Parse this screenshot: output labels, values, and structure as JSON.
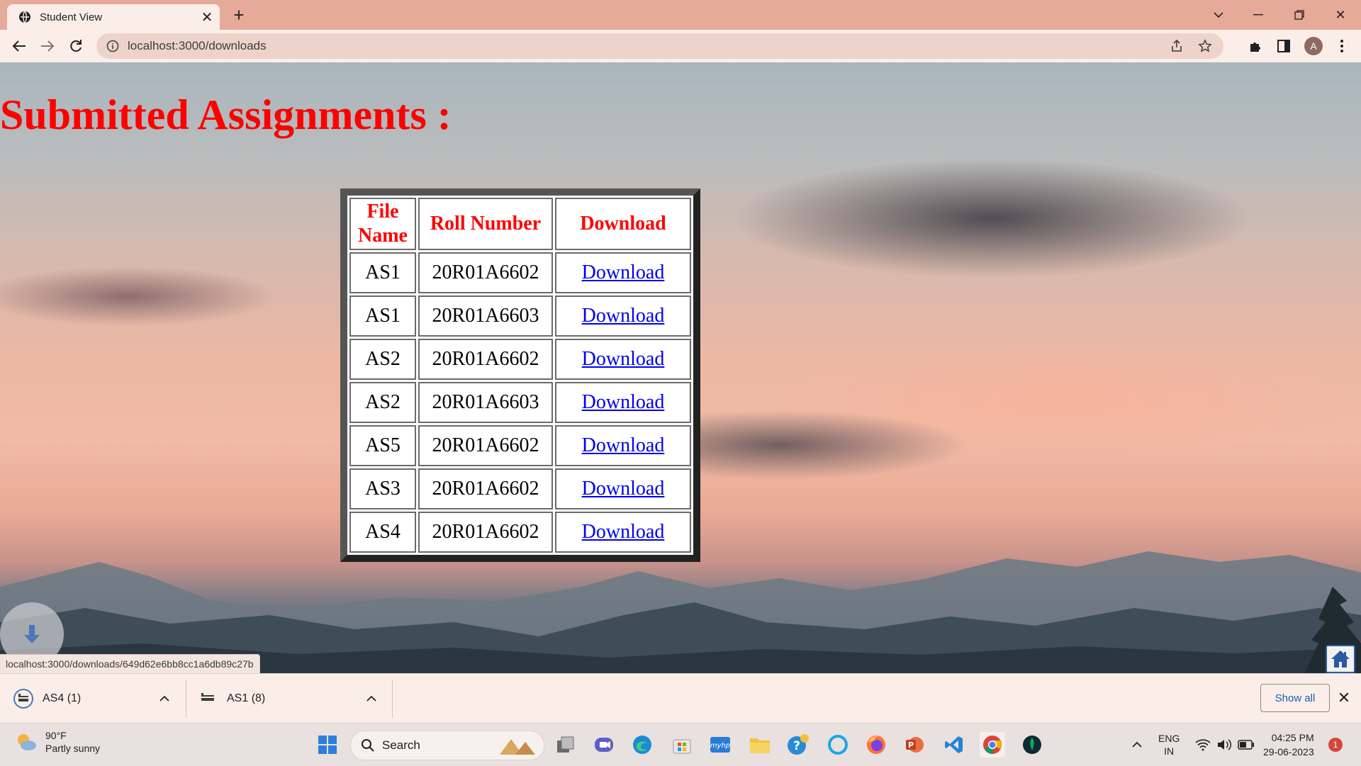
{
  "browser": {
    "tab_title": "Student View",
    "url": "localhost:3000/downloads",
    "profile_initial": "A"
  },
  "page": {
    "title": "Submitted Assignments :",
    "table": {
      "headers": [
        "File Name",
        "Roll Number",
        "Download"
      ],
      "rows": [
        {
          "file": "AS1",
          "roll": "20R01A6602",
          "link": "Download"
        },
        {
          "file": "AS1",
          "roll": "20R01A6603",
          "link": "Download"
        },
        {
          "file": "AS2",
          "roll": "20R01A6602",
          "link": "Download"
        },
        {
          "file": "AS2",
          "roll": "20R01A6603",
          "link": "Download"
        },
        {
          "file": "AS5",
          "roll": "20R01A6602",
          "link": "Download"
        },
        {
          "file": "AS3",
          "roll": "20R01A6602",
          "link": "Download"
        },
        {
          "file": "AS4",
          "roll": "20R01A6602",
          "link": "Download"
        }
      ]
    },
    "status_url": "localhost:3000/downloads/649d62e6bb8cc1a6db89c27b"
  },
  "downloads": {
    "items": [
      {
        "name": "AS4 (1)"
      },
      {
        "name": "AS1 (8)"
      }
    ],
    "show_all": "Show all"
  },
  "taskbar": {
    "weather_temp": "90°F",
    "weather_desc": "Partly sunny",
    "search_label": "Search",
    "lang_top": "ENG",
    "lang_bottom": "IN",
    "time": "04:25 PM",
    "date": "29-06-2023",
    "notification_count": "1"
  },
  "colors": {
    "heading": "#ff0000",
    "link": "#0000ee",
    "chrome": "#e6aa98"
  }
}
